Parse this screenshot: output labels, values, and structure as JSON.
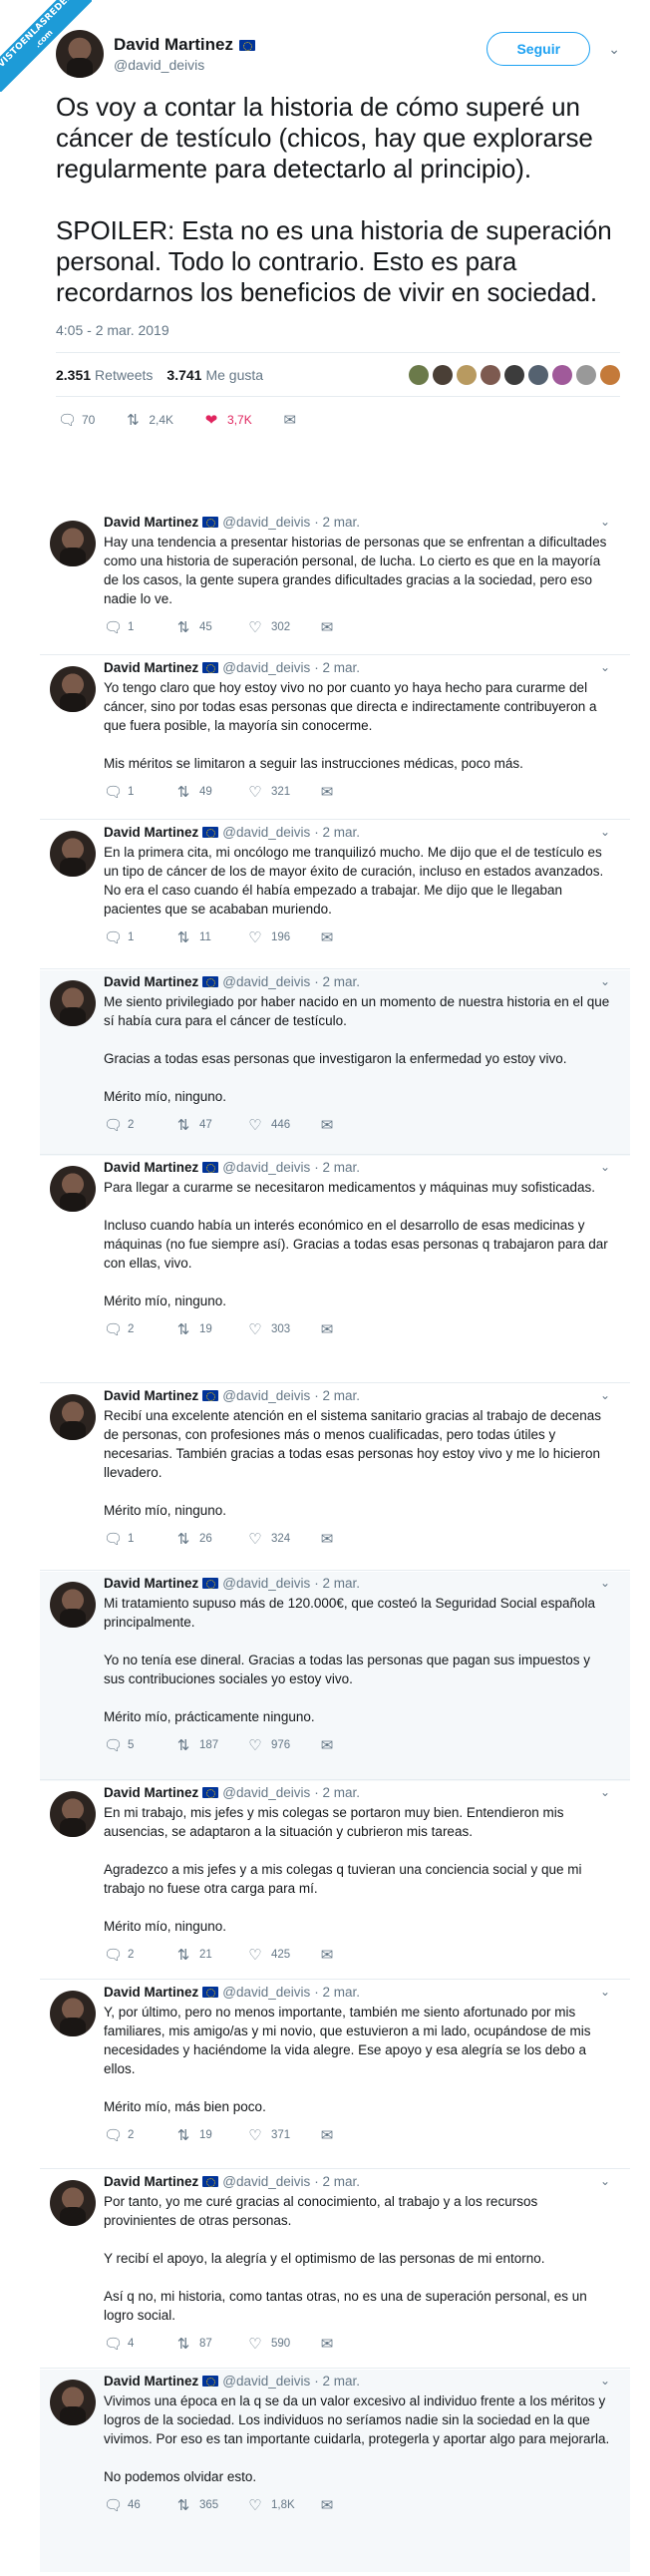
{
  "badge": {
    "site": "VISTOENLASREDES",
    "tld": ".com"
  },
  "main": {
    "name": "David Martinez",
    "handle": "@david_deivis",
    "follow_label": "Seguir",
    "text": "Os voy a contar la historia de cómo superé un cáncer de testículo (chicos, hay que explorarse regularmente para detectarlo al principio).\n\nSPOILER: Esta no es una historia de superación personal. Todo lo contrario. Esto es para recordarnos los beneficios de vivir en sociedad.",
    "date": "4:05 - 2 mar. 2019",
    "retweets": "2.351",
    "retweets_label": "Retweets",
    "likes": "3.741",
    "likes_label": "Me gusta",
    "reply_count": "70",
    "retweet_count": "2,4K",
    "like_count": "3,7K"
  },
  "replies": [
    {
      "name": "David Martinez",
      "handle": "@david_deivis",
      "date": "· 2 mar.",
      "text": "Hay una tendencia a presentar historias de personas que se enfrentan a dificultades como una historia de superación personal, de lucha. Lo cierto es que en la mayoría de los casos, la gente supera grandes dificultades gracias a la sociedad, pero eso nadie lo ve.",
      "r": "1",
      "rt": "45",
      "l": "302"
    },
    {
      "name": "David Martinez",
      "handle": "@david_deivis",
      "date": "· 2 mar.",
      "text": "Yo tengo claro que hoy estoy vivo no por cuanto yo haya hecho para curarme del cáncer, sino por todas esas personas que directa e indirectamente contribuyeron a que fuera posible, la mayoría sin conocerme.\n\nMis méritos se limitaron a seguir las instrucciones médicas, poco más.",
      "r": "1",
      "rt": "49",
      "l": "321"
    },
    {
      "name": "David Martinez",
      "handle": "@david_deivis",
      "date": "· 2 mar.",
      "text": "En la primera cita, mi oncólogo me tranquilizó mucho. Me dijo que el de testículo es un tipo de cáncer de los de mayor éxito de curación, incluso en estados avanzados. No era el caso cuando él había empezado a trabajar. Me dijo que le llegaban pacientes que se acababan muriendo.",
      "r": "1",
      "rt": "11",
      "l": "196"
    },
    {
      "name": "David Martinez",
      "handle": "@david_deivis",
      "date": "· 2 mar.",
      "text": "Me siento privilegiado por haber nacido en un momento de nuestra historia en el que sí había cura para el cáncer de testículo.\n\nGracias a todas esas personas que investigaron la enfermedad yo estoy vivo.\n\nMérito mío, ninguno.",
      "r": "2",
      "rt": "47",
      "l": "446"
    },
    {
      "name": "David Martinez",
      "handle": "@david_deivis",
      "date": "· 2 mar.",
      "text": "Para llegar a curarme se necesitaron medicamentos y máquinas muy sofisticadas.\n\nIncluso cuando había un interés económico en el desarrollo de esas medicinas y máquinas (no fue siempre así). Gracias a todas esas personas q trabajaron para dar con ellas, vivo.\n\nMérito mío, ninguno.",
      "r": "2",
      "rt": "19",
      "l": "303"
    },
    {
      "name": "David Martinez",
      "handle": "@david_deivis",
      "date": "· 2 mar.",
      "text": "Recibí una excelente atención en el sistema sanitario gracias al trabajo de decenas de personas, con profesiones más o menos cualificadas, pero todas útiles y necesarias. También gracias a todas esas personas hoy estoy vivo y me lo hicieron llevadero.\n\nMérito mío, ninguno.",
      "r": "1",
      "rt": "26",
      "l": "324"
    },
    {
      "name": "David Martinez",
      "handle": "@david_deivis",
      "date": "· 2 mar.",
      "text": "Mi tratamiento supuso más de 120.000€, que costeó la Seguridad Social española principalmente.\n\nYo no tenía ese dineral. Gracias a todas las personas que pagan sus impuestos y sus contribuciones sociales yo estoy vivo.\n\nMérito mío, prácticamente ninguno.",
      "r": "5",
      "rt": "187",
      "l": "976"
    },
    {
      "name": "David Martinez",
      "handle": "@david_deivis",
      "date": "· 2 mar.",
      "text": "En mi trabajo, mis jefes y mis colegas se portaron muy bien. Entendieron mis ausencias, se adaptaron a la situación y cubrieron mis tareas.\n\nAgradezco a mis jefes y a mis colegas q tuvieran una conciencia social y que mi trabajo no fuese otra carga para mí.\n\nMérito mío, ninguno.",
      "r": "2",
      "rt": "21",
      "l": "425"
    },
    {
      "name": "David Martinez",
      "handle": "@david_deivis",
      "date": "· 2 mar.",
      "text": "Y, por último, pero no menos importante, también me siento afortunado por mis familiares, mis amigo/as y mi novio, que estuvieron a mi lado, ocupándose de mis necesidades y haciéndome la vida alegre. Ese apoyo y esa alegría se los debo a ellos.\n\nMérito mío, más bien poco.",
      "r": "2",
      "rt": "19",
      "l": "371"
    },
    {
      "name": "David Martinez",
      "handle": "@david_deivis",
      "date": "· 2 mar.",
      "text": "Por tanto, yo me curé gracias al conocimiento, al trabajo y a los recursos provinientes de otras personas.\n\nY recibí el apoyo, la alegría y el optimismo de las personas de mi entorno.\n\nAsí q no, mi historia, como tantas otras, no es una de superación personal, es un logro social.",
      "r": "4",
      "rt": "87",
      "l": "590"
    },
    {
      "name": "David Martinez",
      "handle": "@david_deivis",
      "date": "· 2 mar.",
      "text": "Vivimos una época en la q se da un valor excesivo al individuo frente a los méritos y logros de la sociedad. Los individuos no seríamos nadie sin la sociedad en la que vivimos. Por eso es tan importante cuidarla, protegerla y aportar algo para mejorarla.\n\nNo podemos olvidar esto.",
      "r": "46",
      "rt": "365",
      "l": "1,8K"
    }
  ]
}
